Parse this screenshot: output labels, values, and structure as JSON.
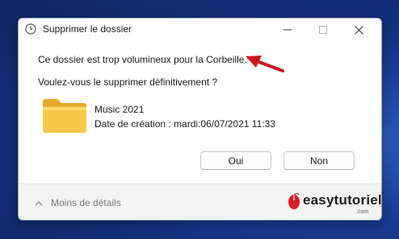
{
  "window": {
    "title": "Supprimer le dossier",
    "title_icon": "clock-icon"
  },
  "titlebar_buttons": [
    "minimize-icon",
    "maximize-icon",
    "close-icon"
  ],
  "message": {
    "line1": "Ce dossier est trop volumineux pour la Corbeille.",
    "line2": "Voulez-vous le supprimer définitivement ?"
  },
  "item": {
    "icon": "folder-icon",
    "name": "Music 2021",
    "date": "Date de création : mardi:06/07/2021 11:33"
  },
  "buttons": {
    "yes": "Oui",
    "no": "Non"
  },
  "footer": {
    "details_label": "Moins de détails"
  },
  "watermark": {
    "text": "easytutoriel",
    "subtext": ".com"
  },
  "colors": {
    "arrow": "#c8171b",
    "folder": "#f5c542",
    "desktop": "#1b3f9a"
  }
}
